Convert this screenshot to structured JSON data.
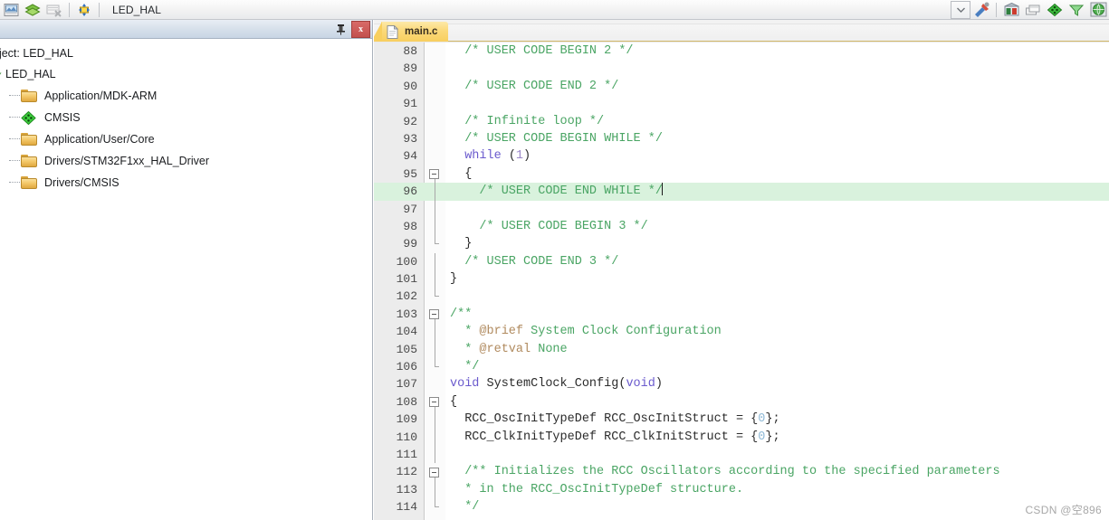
{
  "toolbar": {
    "project_name": "LED_HAL",
    "icons_left": [
      {
        "name": "new-project-icon"
      },
      {
        "name": "layers-icon"
      },
      {
        "name": "close-project-icon"
      },
      {
        "name": "target-options-icon"
      }
    ],
    "icons_right": [
      {
        "name": "chevron-down-icon",
        "glyph": "⌄"
      },
      {
        "name": "build-tools-icon"
      },
      {
        "name": "manage-project-items-icon"
      },
      {
        "name": "books-icon"
      },
      {
        "name": "pack-installer-icon"
      },
      {
        "name": "funnel-icon"
      },
      {
        "name": "globe-icon"
      }
    ]
  },
  "project_panel": {
    "pin_icon": "pin-icon",
    "close_label": "x",
    "header": "oject: LED_HAL",
    "tree": [
      {
        "label": "LED_HAL",
        "icon": "expanded-twisty-icon",
        "level": 0
      },
      {
        "label": "Application/MDK-ARM",
        "icon": "folder-icon",
        "level": 1
      },
      {
        "label": "CMSIS",
        "icon": "cmsis-diamond-icon",
        "level": 1
      },
      {
        "label": "Application/User/Core",
        "icon": "folder-icon",
        "level": 1
      },
      {
        "label": "Drivers/STM32F1xx_HAL_Driver",
        "icon": "folder-icon",
        "level": 1
      },
      {
        "label": "Drivers/CMSIS",
        "icon": "folder-icon",
        "level": 1
      }
    ]
  },
  "editor": {
    "tab": {
      "label": "main.c",
      "icon": "document-icon",
      "active": true
    },
    "highlighted_line": 96,
    "lines": [
      {
        "n": 88,
        "fold": "none",
        "segments": [
          {
            "t": "  /* USER CODE BEGIN 2 */",
            "c": "cm"
          }
        ]
      },
      {
        "n": 89,
        "fold": "none",
        "segments": []
      },
      {
        "n": 90,
        "fold": "none",
        "segments": [
          {
            "t": "  /* USER CODE END 2 */",
            "c": "cm"
          }
        ]
      },
      {
        "n": 91,
        "fold": "none",
        "segments": []
      },
      {
        "n": 92,
        "fold": "none",
        "segments": [
          {
            "t": "  /* Infinite loop */",
            "c": "cm"
          }
        ]
      },
      {
        "n": 93,
        "fold": "none",
        "segments": [
          {
            "t": "  /* USER CODE BEGIN WHILE */",
            "c": "cm"
          }
        ]
      },
      {
        "n": 94,
        "fold": "none",
        "segments": [
          {
            "t": "  ",
            "c": "id"
          },
          {
            "t": "while",
            "c": "kw"
          },
          {
            "t": " (",
            "c": "id"
          },
          {
            "t": "1",
            "c": "pl"
          },
          {
            "t": ")",
            "c": "id"
          }
        ]
      },
      {
        "n": 95,
        "fold": "open",
        "segments": [
          {
            "t": "  {",
            "c": "id"
          }
        ]
      },
      {
        "n": 96,
        "fold": "line",
        "segments": [
          {
            "t": "    /* USER CODE END WHILE */",
            "c": "cm"
          }
        ],
        "caret": true
      },
      {
        "n": 97,
        "fold": "line",
        "segments": []
      },
      {
        "n": 98,
        "fold": "line",
        "segments": [
          {
            "t": "    /* USER CODE BEGIN 3 */",
            "c": "cm"
          }
        ]
      },
      {
        "n": 99,
        "fold": "endhook",
        "segments": [
          {
            "t": "  }",
            "c": "id"
          }
        ]
      },
      {
        "n": 100,
        "fold": "line",
        "segments": [
          {
            "t": "  /* USER CODE END 3 */",
            "c": "cm"
          }
        ]
      },
      {
        "n": 101,
        "fold": "line",
        "segments": [
          {
            "t": "}",
            "c": "id"
          }
        ]
      },
      {
        "n": 102,
        "fold": "endhook",
        "segments": []
      },
      {
        "n": 103,
        "fold": "open",
        "segments": [
          {
            "t": "/**",
            "c": "cm"
          }
        ]
      },
      {
        "n": 104,
        "fold": "line",
        "segments": [
          {
            "t": "  * ",
            "c": "cm"
          },
          {
            "t": "@brief",
            "c": "doc"
          },
          {
            "t": " System Clock Configuration",
            "c": "cm"
          }
        ]
      },
      {
        "n": 105,
        "fold": "line",
        "segments": [
          {
            "t": "  * ",
            "c": "cm"
          },
          {
            "t": "@retval",
            "c": "doc"
          },
          {
            "t": " None",
            "c": "cm"
          }
        ]
      },
      {
        "n": 106,
        "fold": "endhook",
        "segments": [
          {
            "t": "  */",
            "c": "cm"
          }
        ]
      },
      {
        "n": 107,
        "fold": "none",
        "segments": [
          {
            "t": "",
            "c": "id"
          },
          {
            "t": "void",
            "c": "kw"
          },
          {
            "t": " SystemClock_Config(",
            "c": "id"
          },
          {
            "t": "void",
            "c": "kw"
          },
          {
            "t": ")",
            "c": "id"
          }
        ]
      },
      {
        "n": 108,
        "fold": "open",
        "segments": [
          {
            "t": "{",
            "c": "id"
          }
        ]
      },
      {
        "n": 109,
        "fold": "line",
        "segments": [
          {
            "t": "  RCC_OscInitTypeDef RCC_OscInitStruct = {",
            "c": "id"
          },
          {
            "t": "0",
            "c": "num"
          },
          {
            "t": "};",
            "c": "id"
          }
        ]
      },
      {
        "n": 110,
        "fold": "line",
        "segments": [
          {
            "t": "  RCC_ClkInitTypeDef RCC_ClkInitStruct = {",
            "c": "id"
          },
          {
            "t": "0",
            "c": "num"
          },
          {
            "t": "};",
            "c": "id"
          }
        ]
      },
      {
        "n": 111,
        "fold": "line",
        "segments": []
      },
      {
        "n": 112,
        "fold": "open",
        "segments": [
          {
            "t": "  /** Initializes the RCC Oscillators according to the specified parameters",
            "c": "cm"
          }
        ]
      },
      {
        "n": 113,
        "fold": "line",
        "segments": [
          {
            "t": "  * in the RCC_OscInitTypeDef structure.",
            "c": "cm"
          }
        ]
      },
      {
        "n": 114,
        "fold": "endhook",
        "segments": [
          {
            "t": "  */",
            "c": "cm"
          }
        ]
      }
    ]
  },
  "watermark": "CSDN @空896",
  "colors": {
    "comment": "#4aa564",
    "doc_tag": "#b08a5e",
    "keyword": "#6a5acd",
    "number": "#8fb9d6",
    "highlight_line": "#d9f2dd",
    "tab_active": "#f8cf5f",
    "panel_title": "#c8d5e4",
    "close_button": "#c3504e"
  }
}
